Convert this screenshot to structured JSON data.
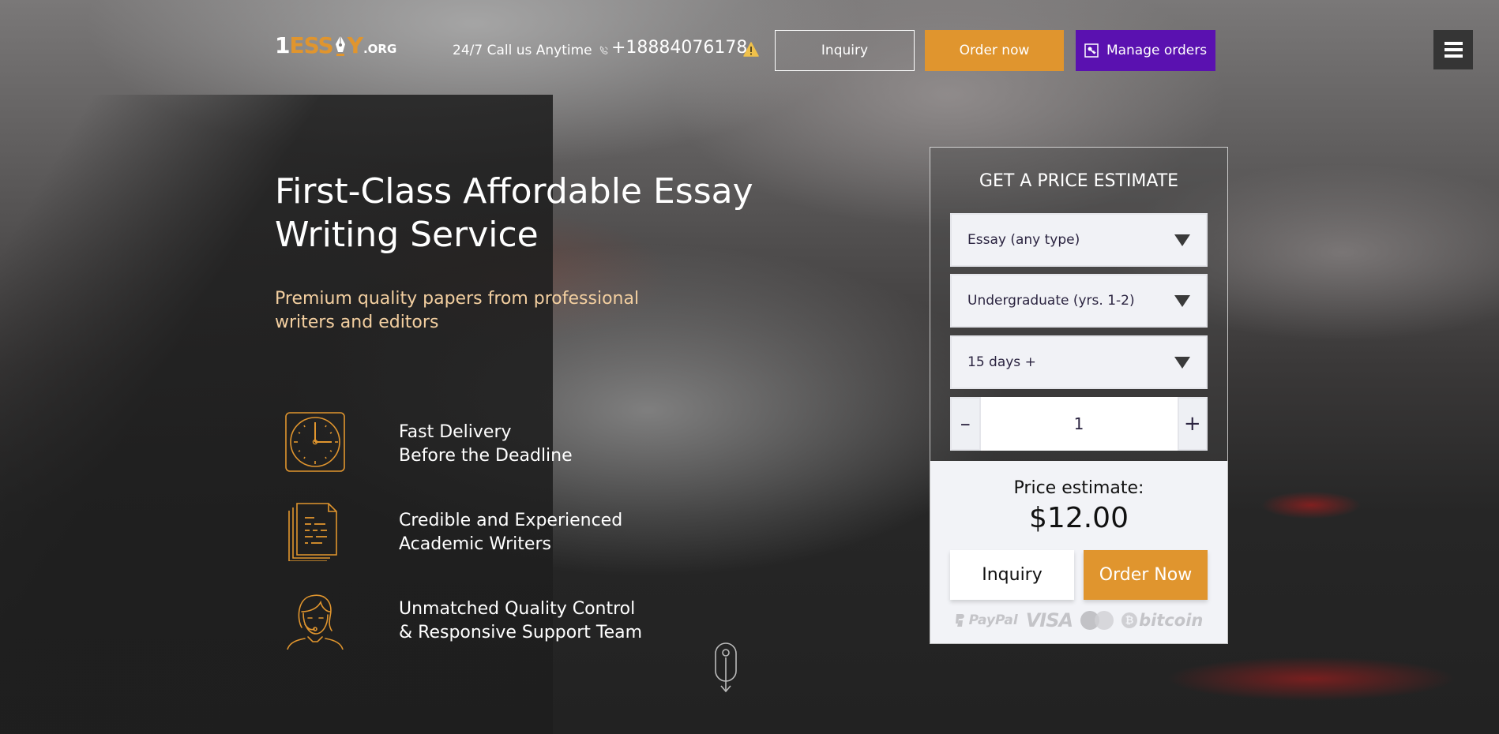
{
  "brand": {
    "logo_parts": {
      "one": "1",
      "ess": "ESS",
      "y": "Y",
      "org": ".ORG"
    },
    "accent_color": "#e0952e",
    "purple_color": "#5a11b0"
  },
  "header": {
    "call_label": "24/7 Call us Anytime",
    "phone": "+18884076178",
    "icons": {
      "phone": "phone-icon",
      "warning": "warning-icon",
      "menu": "hamburger-icon",
      "key": "key-icon"
    },
    "buttons": {
      "inquiry": "Inquiry",
      "order_now": "Order now",
      "manage_orders": "Manage orders"
    }
  },
  "hero": {
    "title": "First-Class Affordable Essay Writing Service",
    "subtitle": "Premium quality papers from professional writers and editors"
  },
  "features": [
    {
      "icon": "clock-icon",
      "line1": "Fast Delivery",
      "line2": "Before the Deadline"
    },
    {
      "icon": "documents-icon",
      "line1": "Credible and Experienced",
      "line2": "Academic Writers"
    },
    {
      "icon": "support-agent-icon",
      "line1": "Unmatched Quality Control",
      "line2": "& Responsive Support Team"
    }
  ],
  "price_panel": {
    "title": "GET A PRICE ESTIMATE",
    "paper_type": "Essay (any type)",
    "academic_level": "Undergraduate (yrs. 1-2)",
    "deadline": "15 days +",
    "pages": "1",
    "minus_label": "–",
    "plus_label": "+",
    "price_label": "Price estimate:",
    "price_value": "$12.00",
    "inquiry_label": "Inquiry",
    "order_label": "Order Now",
    "payment_methods": [
      "PayPal",
      "VISA",
      "MasterCard",
      "bitcoin"
    ]
  }
}
